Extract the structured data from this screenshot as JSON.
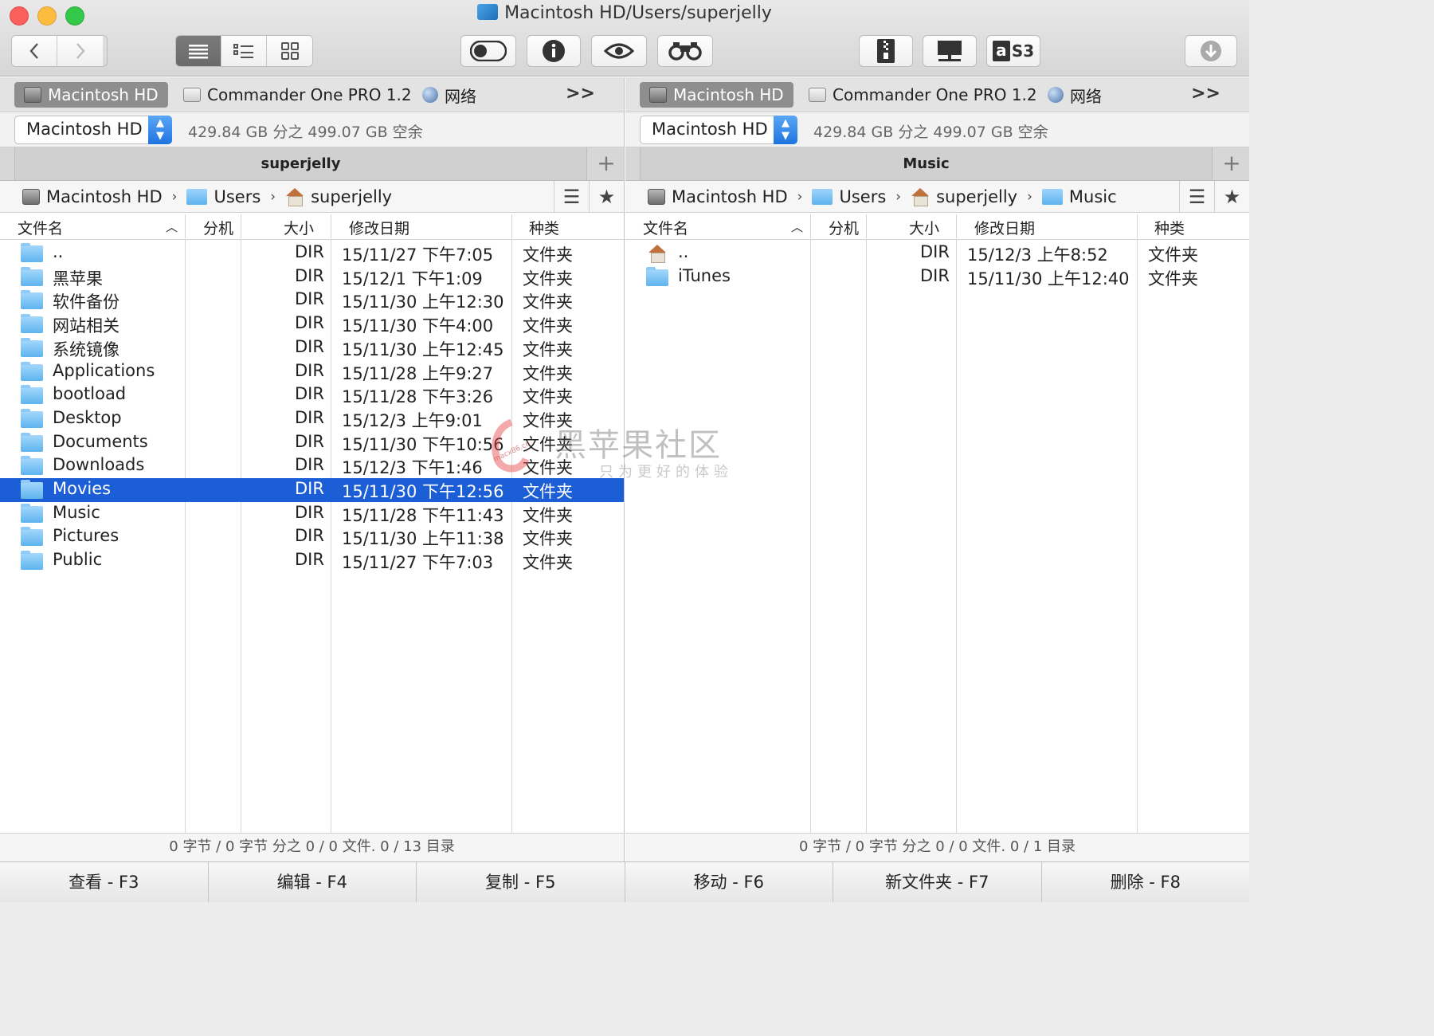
{
  "window": {
    "title": "Macintosh HD/Users/superjelly"
  },
  "toolbar": {
    "icons": [
      "back-icon",
      "forward-icon",
      "list-view-icon",
      "detail-view-icon",
      "icon-view-icon",
      "toggle-icon",
      "info-icon",
      "eye-icon",
      "binoculars-icon",
      "zip-icon",
      "network-icon",
      "s3-icon",
      "download-icon"
    ],
    "s3_label": "S3"
  },
  "left": {
    "drives": [
      "Macintosh HD",
      "Commander One PRO 1.2",
      "网络"
    ],
    "more": ">>",
    "disk": "Macintosh HD",
    "free": "429.84 GB 分之 499.07 GB 空余",
    "tab": "superjelly",
    "crumbs": [
      "Macintosh HD",
      "Users",
      "superjelly"
    ],
    "cols": [
      "文件名",
      "分机",
      "大小",
      "修改日期",
      "种类"
    ],
    "rows": [
      {
        "name": "..",
        "size": "DIR",
        "date": "15/11/27 下午7:05",
        "kind": "文件夹"
      },
      {
        "name": "黑苹果",
        "size": "DIR",
        "date": "15/12/1 下午1:09",
        "kind": "文件夹"
      },
      {
        "name": "软件备份",
        "size": "DIR",
        "date": "15/11/30 上午12:30",
        "kind": "文件夹"
      },
      {
        "name": "网站相关",
        "size": "DIR",
        "date": "15/11/30 下午4:00",
        "kind": "文件夹"
      },
      {
        "name": "系统镜像",
        "size": "DIR",
        "date": "15/11/30 上午12:45",
        "kind": "文件夹"
      },
      {
        "name": "Applications",
        "size": "DIR",
        "date": "15/11/28 上午9:27",
        "kind": "文件夹"
      },
      {
        "name": "bootload",
        "size": "DIR",
        "date": "15/11/28 下午3:26",
        "kind": "文件夹"
      },
      {
        "name": "Desktop",
        "size": "DIR",
        "date": "15/12/3 上午9:01",
        "kind": "文件夹"
      },
      {
        "name": "Documents",
        "size": "DIR",
        "date": "15/11/30 下午10:56",
        "kind": "文件夹"
      },
      {
        "name": "Downloads",
        "size": "DIR",
        "date": "15/12/3 下午1:46",
        "kind": "文件夹"
      },
      {
        "name": "Movies",
        "size": "DIR",
        "date": "15/11/30 下午12:56",
        "kind": "文件夹"
      },
      {
        "name": "Music",
        "size": "DIR",
        "date": "15/11/28 下午11:43",
        "kind": "文件夹"
      },
      {
        "name": "Pictures",
        "size": "DIR",
        "date": "15/11/30 上午11:38",
        "kind": "文件夹"
      },
      {
        "name": "Public",
        "size": "DIR",
        "date": "15/11/27 下午7:03",
        "kind": "文件夹"
      }
    ],
    "selected": "Movies",
    "status": "0 字节 / 0 字节 分之 0 / 0 文件. 0 / 13 目录"
  },
  "right": {
    "drives": [
      "Macintosh HD",
      "Commander One PRO 1.2",
      "网络"
    ],
    "more": ">>",
    "disk": "Macintosh HD",
    "free": "429.84 GB 分之 499.07 GB 空余",
    "tab": "Music",
    "crumbs": [
      "Macintosh HD",
      "Users",
      "superjelly",
      "Music"
    ],
    "cols": [
      "文件名",
      "分机",
      "大小",
      "修改日期",
      "种类"
    ],
    "rows": [
      {
        "name": "..",
        "size": "DIR",
        "date": "15/12/3 上午8:52",
        "kind": "文件夹"
      },
      {
        "name": "iTunes",
        "size": "DIR",
        "date": "15/11/30 上午12:40",
        "kind": "文件夹"
      }
    ],
    "status": "0 字节 / 0 字节 分之 0 / 0 文件. 0 / 1 目录"
  },
  "fkeys": [
    "查看 - F3",
    "编辑 - F4",
    "复制 - F5",
    "移动 - F6",
    "新文件夹 - F7",
    "删除 - F8"
  ],
  "watermark": {
    "line1": "黑苹果社区",
    "line2": "只为更好的体验",
    "url": "macx86.cn"
  },
  "colors": {
    "selection": "#1c5ed6",
    "folder": "#5cb4ef",
    "close": "#fc605c",
    "minimize": "#fdbc40",
    "zoom": "#34c84a"
  }
}
